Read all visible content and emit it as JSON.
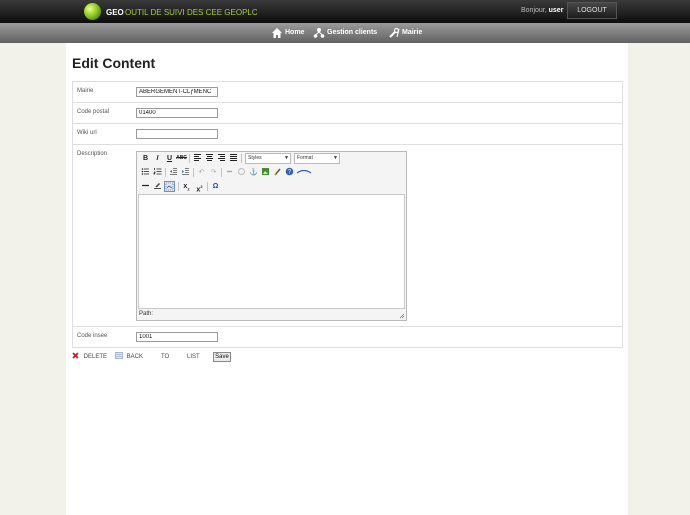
{
  "header": {
    "brand": "GEO",
    "subtitle": "OUTIL DE SUIVI DES CEE GEOPLC",
    "greeting_prefix": "Bonjour,",
    "username": "user",
    "logout_label": "LOGOUT"
  },
  "nav": {
    "items": [
      {
        "label": "Home",
        "icon": "home-icon"
      },
      {
        "label": "Gestion clients",
        "icon": "users-icon"
      },
      {
        "label": "Mairie",
        "icon": "tools-icon"
      }
    ]
  },
  "page": {
    "title": "Edit Content"
  },
  "form": {
    "mairie": {
      "label": "Mairie",
      "value": "ABERGEMENT-CLƒMENC"
    },
    "code_postal": {
      "label": "Code postal",
      "value": "01400"
    },
    "wiki_url": {
      "label": "Wiki url",
      "value": ""
    },
    "description": {
      "label": "Description"
    },
    "code_insee": {
      "label": "Code insee",
      "value": "1001"
    }
  },
  "editor": {
    "styles_label": "Styles",
    "format_label": "Format",
    "path_label": "Path:",
    "content": ""
  },
  "actions": {
    "delete_label": "DELETE",
    "back_label": "BACK",
    "to_label": "TO",
    "list_label": "LIST",
    "save_label": "Save"
  }
}
